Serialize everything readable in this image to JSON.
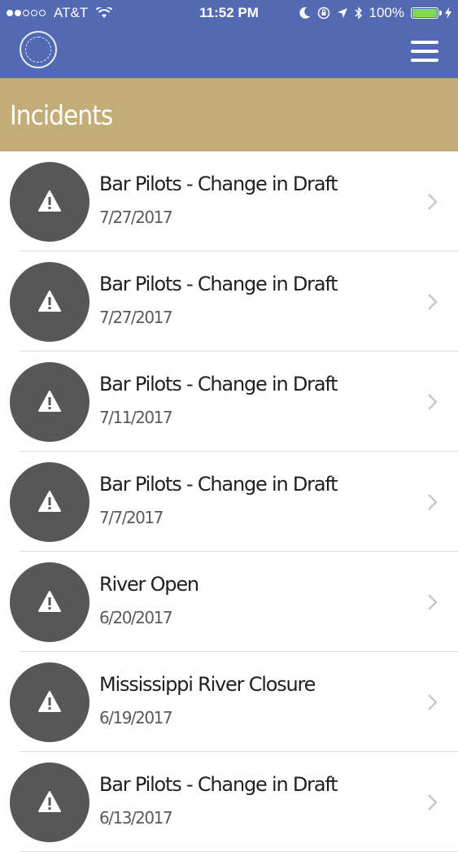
{
  "status_bar": {
    "carrier": "AT&T",
    "time": "11:52 PM",
    "battery": "100%"
  },
  "nav": {
    "logo": "seal-logo",
    "menu_icon": "hamburger-menu-icon"
  },
  "page": {
    "title": "Incidents"
  },
  "colors": {
    "nav_bg": "#5469b3",
    "header_bg": "#c2ac77",
    "icon_bg": "#575757",
    "battery": "#7ed957"
  },
  "incidents": [
    {
      "title": "Bar Pilots - Change in Draft",
      "date": "7/27/2017"
    },
    {
      "title": "Bar Pilots - Change in Draft",
      "date": "7/27/2017"
    },
    {
      "title": "Bar Pilots - Change in Draft",
      "date": "7/11/2017"
    },
    {
      "title": "Bar Pilots - Change in Draft",
      "date": "7/7/2017"
    },
    {
      "title": "River Open",
      "date": "6/20/2017"
    },
    {
      "title": "Mississippi River Closure",
      "date": "6/19/2017"
    },
    {
      "title": "Bar Pilots - Change in Draft",
      "date": "6/13/2017"
    }
  ]
}
